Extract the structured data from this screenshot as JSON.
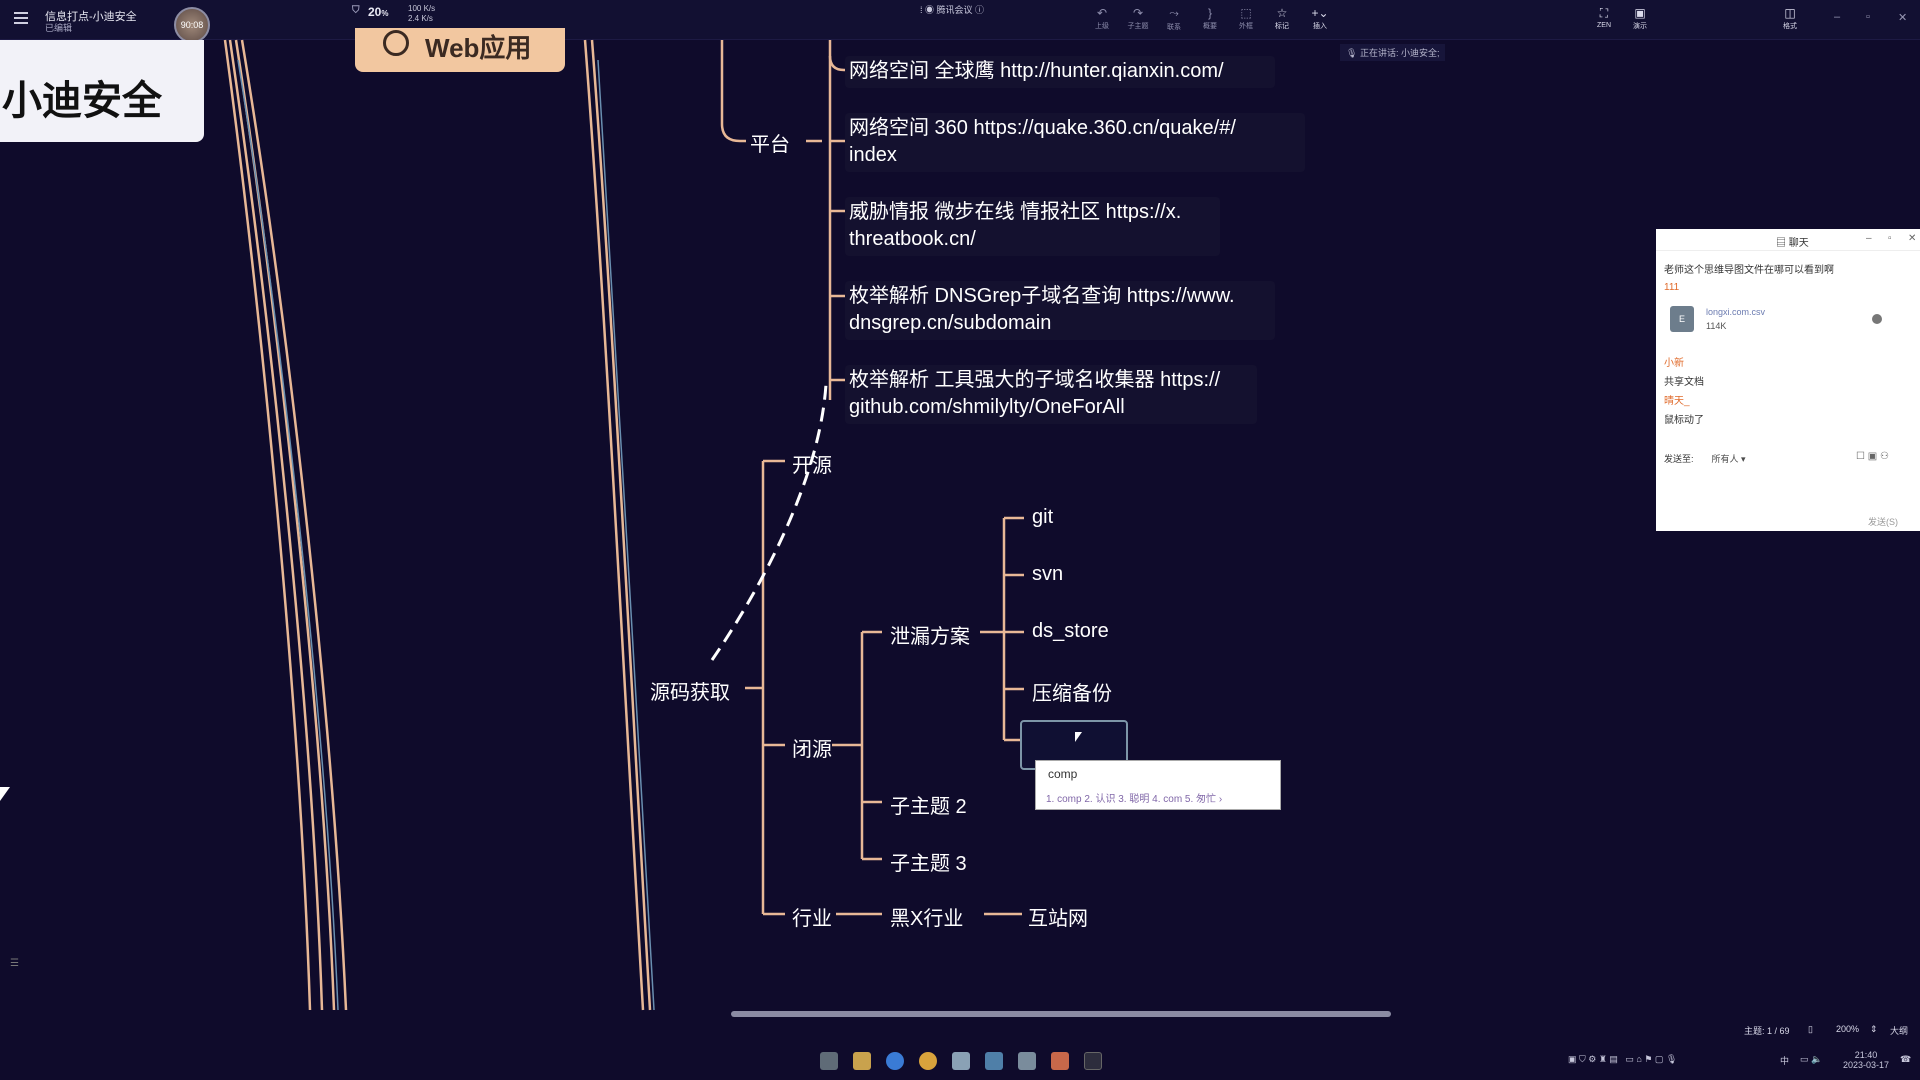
{
  "topbar": {
    "doc_title": "信息打点-小迪安全",
    "doc_status": "已编辑",
    "timer": "90:08",
    "cpu": "20",
    "cpu_unit": "%",
    "net_up": "100 K/s",
    "net_down": "2.4 K/s",
    "meeting": "腾讯会议",
    "tools": [
      {
        "icon": "undo-icon",
        "label": "上级"
      },
      {
        "icon": "redo-icon",
        "label": "子主题"
      },
      {
        "icon": "relation-icon",
        "label": "联系"
      },
      {
        "icon": "summary-icon",
        "label": "概要"
      },
      {
        "icon": "boundary-icon",
        "label": "外框"
      },
      {
        "icon": "star-icon",
        "label": "标记"
      },
      {
        "icon": "plus-icon",
        "label": "插入"
      },
      {
        "icon": "zen-icon",
        "label": "ZEN"
      },
      {
        "icon": "present-icon",
        "label": "演示"
      },
      {
        "icon": "format-icon",
        "label": "格式"
      }
    ],
    "speaking": "正在讲话: 小迪安全;"
  },
  "title_card": "小迪安全",
  "web_node": "Web应用",
  "mindmap": {
    "platform": "平台",
    "leaves": [
      "网络空间 全球鹰 http://hunter.qianxin.com/",
      "网络空间 360  https://quake.360.cn/quake/#/\nindex",
      "威胁情报 微步在线 情报社区 https://x.\nthreatbook.cn/",
      "枚举解析 DNSGrep子域名查询 https://www.\ndnsgrep.cn/subdomain",
      "枚举解析 工具强大的子域名收集器 https://\ngithub.com/shmilylty/OneForAll"
    ],
    "source": "源码获取",
    "open": "开源",
    "closed": "闭源",
    "industry": "行业",
    "leak": "泄漏方案",
    "leak_items": [
      "git",
      "svn",
      "ds_store",
      "压缩备份"
    ],
    "sub2": "子主题 2",
    "sub3": "子主题 3",
    "black": "黑X行业",
    "hub": "互站网"
  },
  "ime": {
    "composition": "comp",
    "candidates": "1. comp  2. 认识  3. 聪明  4. com  5. 匆忙  ›"
  },
  "chat": {
    "title": "聊天",
    "question": "老师这个思维导图文件在哪可以看到啊",
    "reply1": "111",
    "file_name": "longxi.com.csv",
    "file_size": "114K",
    "user1": "小新",
    "msg1": "共享文档",
    "user2": "晴天_",
    "msg2": "鼠标动了",
    "send_to_label": "发送至:",
    "send_to_value": "所有人 ▾",
    "send_button": "发送(S)"
  },
  "status": {
    "topic_count": "主题: 1 / 69",
    "zoom": "200%",
    "size": "大纲"
  },
  "tray": {
    "time": "21:40",
    "date": "2023-03-17",
    "lang": "中"
  },
  "colors": {
    "background": "#0f0b2b",
    "branch": "#e8b896",
    "title_card": "#f2f2f8",
    "web_node": "#f2c7a0"
  }
}
